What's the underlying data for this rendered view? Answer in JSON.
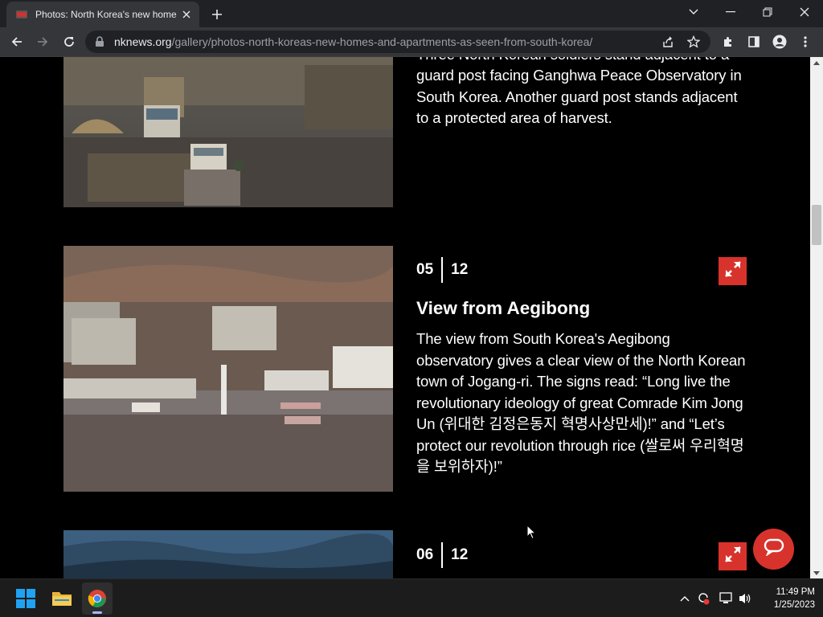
{
  "browser": {
    "tab_title": "Photos: North Korea's new home",
    "url_domain": "nknews.org",
    "url_path": "/gallery/photos-north-koreas-new-homes-and-apartments-as-seen-from-south-korea/"
  },
  "slides": [
    {
      "caption_partial": "Three North Korean soldiers stand adjacent to a",
      "caption": "guard post facing Ganghwa Peace Observatory in South Korea. Another guard post stands adjacent to a protected area of harvest."
    },
    {
      "index": "05",
      "total": "12",
      "title": "View from Aegibong",
      "caption": "The view from South Korea's Aegibong observatory gives a clear view of the North Korean town of Jogang-ri. The signs read: “Long live the revolutionary ideology of great Comrade Kim Jong Un (위대한 김정은동지 혁명사상만세)!” and “Let’s protect our revolution through rice (쌀로써 우리혁명을 보위하자)!”"
    },
    {
      "index": "06",
      "total": "12"
    }
  ],
  "taskbar": {
    "time": "11:49 PM",
    "date": "1/25/2023"
  },
  "colors": {
    "accent_red": "#d7332c",
    "page_bg": "#000000",
    "chrome_dark": "#202124",
    "chrome_toolbar": "#35363a"
  },
  "icons": {
    "expand": "expand-arrows-icon",
    "chat": "chat-bubble-icon"
  }
}
